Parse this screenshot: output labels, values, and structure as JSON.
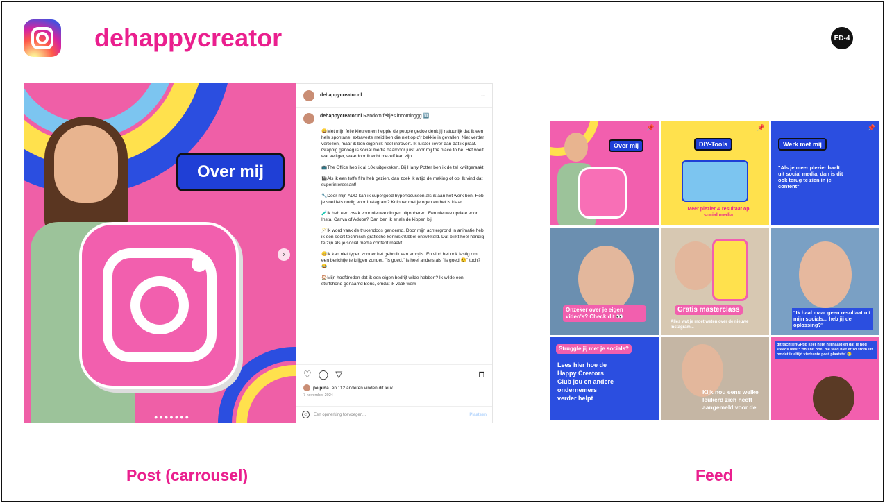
{
  "header": {
    "account": "dehappycreator",
    "badge": "ED-4"
  },
  "post": {
    "image_label": "Over mij",
    "username": "dehappycreator.nl",
    "more": "...",
    "caption_user": "dehappycreator.nl",
    "caption_title": "Random feitjes incominggg 🔟",
    "paragraphs": [
      "😄Met mijn felle kleuren en heppie de peppie gedoe denk jij natuurlijk dat ik een hele spontane, extraverte meid ben die niet op d'r bekkie is gevallen. Niet verder vertellen, maar ik ben eigenlijk heel introvert. Ik luister liever dan dat ik praat. Grappig genoeg is social media daardoor juist voor mij the place to be. Het voelt wat veiliger, waardoor ik echt mezelf kan zijn.",
      "📺The Office heb ik al 10x uitgekeken. Bij Harry Potter ben ik de tel kwijtgeraakt.",
      "🎬Als ik een toffe film heb gezien, dan zoek ik altijd de making of op. Ik vind dat superinteressant!",
      "🔧Door mijn ADD kan ik supergoed hyperfocussen als ik aan het werk ben. Heb je snel iets nodig voor Instagram? Knipper met je ogen en het is klaar.",
      "🧪Ik heb een zwak voor nieuwe dingen uitproberen. Een nieuwe update voor Insta, Canva of Adobe? Dan ben ik er als de kippen bij!",
      "🪄Ik word vaak de trukendoos genoemd. Door mijn achtergrond in animatie heb ik een soort technisch-grafische kenniskn0bbel ontwikkeld. Dat blijkt heel handig te zijn als je social media content maakt.",
      "😅Ik kan niet typen zonder het gebruik van emoji's. En vind het ook lastig om een berichtje te krijgen zonder. \"Is goed.\" is heel anders als \"Is goed!😉\" toch? 😂",
      "🏠Mijn hoofdreden dat ik een eigen bedrijf wilde hebben? Ik wilde een stuffshond genaamd Boris, omdat ik vaak werk"
    ],
    "likes_user": "pelpina",
    "likes_text": "en 112 anderen vinden dit leuk",
    "date": "7 november 2024",
    "comment_placeholder": "Een opmerking toevoegen...",
    "post_button": "Plaatsen",
    "carousel_dots": "●●●●●●●"
  },
  "feed": {
    "tiles": [
      {
        "label": "Over mij"
      },
      {
        "label": "DIY-Tools",
        "sub": "Meer plezier & resultaat op social media"
      },
      {
        "label": "Werk met mij",
        "quote": "\"Als je meer plezier haalt uit social media, dan is dit ook terug te zien in je content\""
      },
      {
        "label": "Onzeker over je eigen video's? Check dit 👀"
      },
      {
        "label": "Gratis masterclass",
        "sub": "Alles wat je moet weten over de nieuwe Instagram..."
      },
      {
        "label": "\"Ik haal maar geen resultaat uit mijn socials... heb jij de oplossing?\""
      },
      {
        "label": "Struggle jij met je socials?",
        "sub": "Lees hier hoe de Happy Creators Club jou en andere ondernemers verder helpt"
      },
      {
        "label": "Kijk nou eens welke leukerd zich heeft aangemeld voor de"
      },
      {
        "label": "dit tachtienGPtig keer hebt herhaald en dat je nog steeds leest: 'oh shit hoe! me feed niet er zo stom uit omdat ik altijd vierkante post plaatste' 😭"
      }
    ]
  },
  "captions": {
    "left": "Post (carrousel)",
    "right": "Feed"
  },
  "colors": {
    "brand_pink": "#ea1f8e",
    "tile_pink": "#f25fae",
    "accent_blue": "#1f3fd6",
    "accent_yellow": "#ffe14d"
  }
}
